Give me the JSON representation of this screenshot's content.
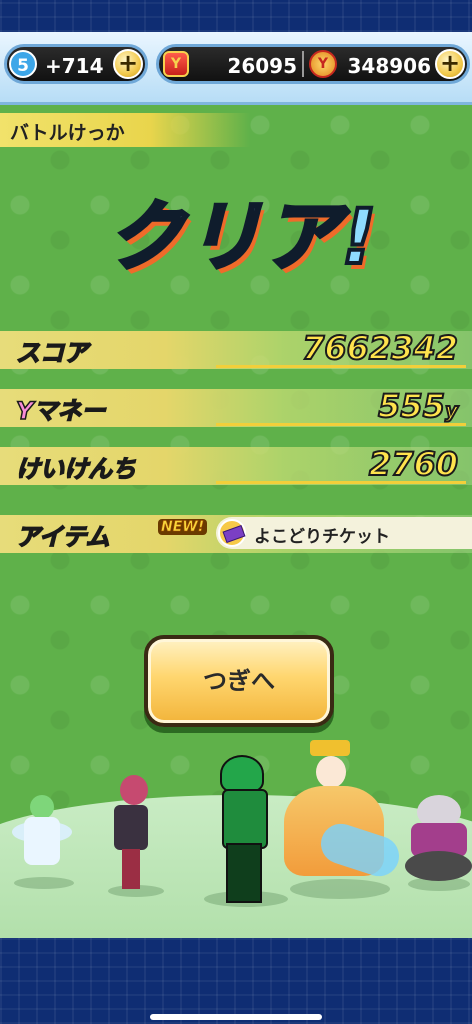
{
  "header": {
    "stamina_level": "5",
    "stamina_value": "+714",
    "money_icon_glyph": "Y",
    "money_value": "26095",
    "points_icon_glyph": "Y",
    "points_value": "348906",
    "plus_glyph": "+"
  },
  "result": {
    "title": "バトルけっか",
    "clear_text": "クリア!"
  },
  "stats": [
    {
      "label": "スコア",
      "value": "7662342"
    },
    {
      "label": "Yマネー",
      "value": "555",
      "unit": "y"
    },
    {
      "label": "けいけんち",
      "value": "2760"
    }
  ],
  "item": {
    "label": "アイテム",
    "new_badge": "NEW!",
    "icon": "ticket-icon",
    "name": "よこどりチケット"
  },
  "next_button": {
    "label": "つぎへ"
  },
  "colors": {
    "background_green": "#5fb14a",
    "frame_navy": "#0f2d73",
    "button_gold": "#ffd66f"
  }
}
